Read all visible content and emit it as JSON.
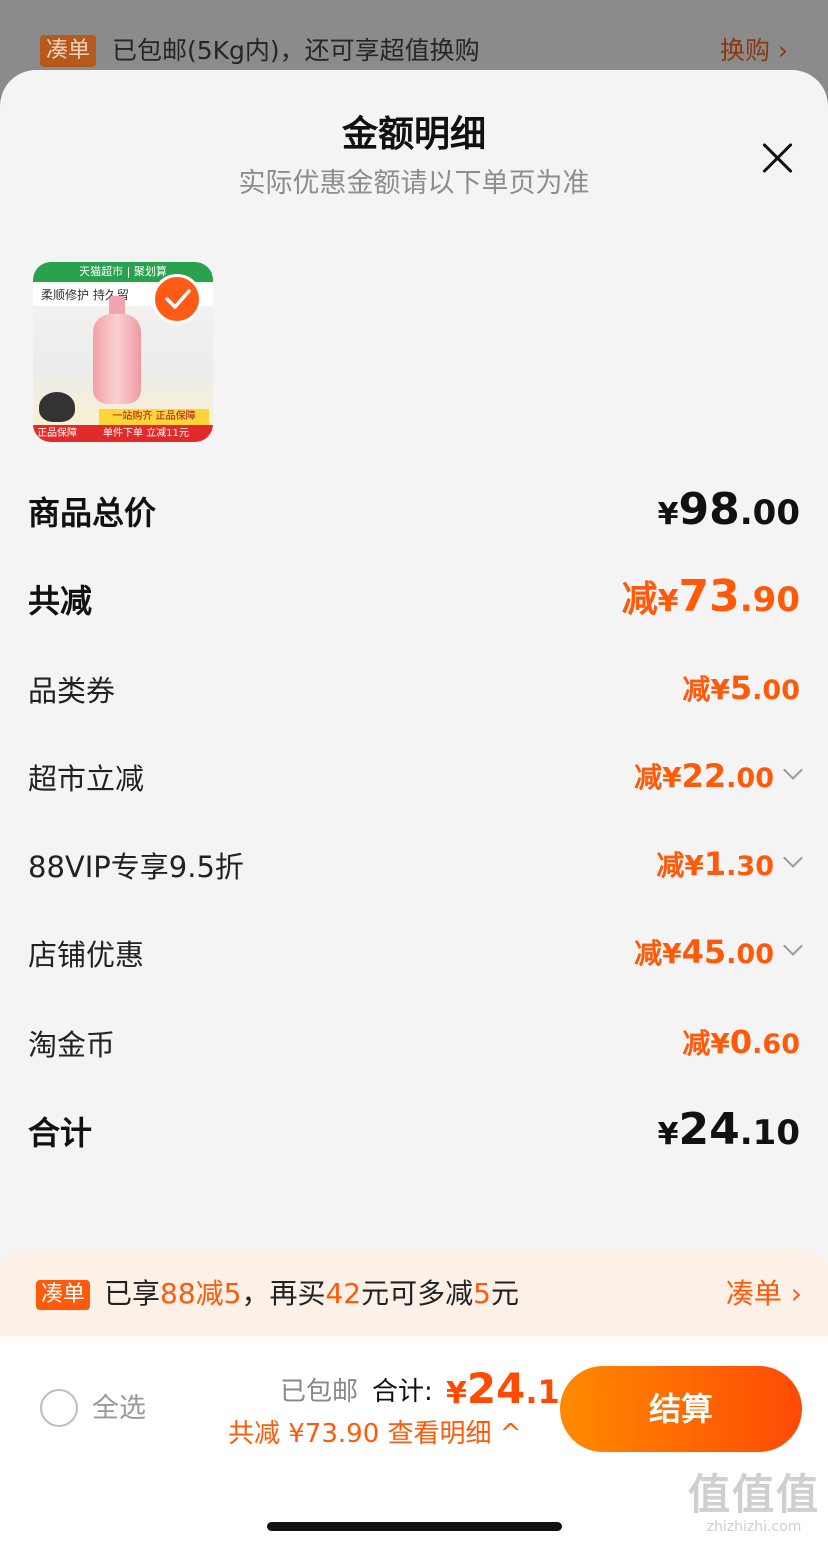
{
  "background_bar": {
    "tag": "凑单",
    "text": "已包邮(5Kg内)，还可享超值换购",
    "action": "换购 ›"
  },
  "sheet": {
    "title": "金额明细",
    "subtitle": "实际优惠金额请以下单页为准"
  },
  "product": {
    "banner": "天猫超市 | 聚划算",
    "slogan": "柔顺修护 持久留",
    "strip_yellow": "一站购齐 正品保障",
    "strip_red": "单件下单 立减11元",
    "guarantee": "正品保障"
  },
  "rows": {
    "total_price": {
      "label": "商品总价",
      "yen": "¥",
      "int": "98",
      "dec": ".00"
    },
    "total_discount": {
      "label": "共减",
      "prefix": "减",
      "yen": "¥",
      "int": "73",
      "dec": ".90"
    },
    "category_coupon": {
      "label": "品类券",
      "prefix": "减",
      "yen": "¥",
      "int": "5",
      "dec": ".00"
    },
    "supermarket_cut": {
      "label": "超市立减",
      "prefix": "减",
      "yen": "¥",
      "int": "22",
      "dec": ".00"
    },
    "vip": {
      "label": "88VIP专享9.5折",
      "prefix": "减",
      "yen": "¥",
      "int": "1",
      "dec": ".30"
    },
    "store": {
      "label": "店铺优惠",
      "prefix": "减",
      "yen": "¥",
      "int": "45",
      "dec": ".00"
    },
    "coins": {
      "label": "淘金币",
      "prefix": "减",
      "yen": "¥",
      "int": "0",
      "dec": ".60"
    },
    "sum": {
      "label": "合计",
      "yen": "¥",
      "int": "24",
      "dec": ".10"
    }
  },
  "promo": {
    "tag": "凑单",
    "t1": "已享",
    "h1": "88减5",
    "t2": "，再买",
    "h2": "42",
    "t3": "元可多减",
    "h3": "5",
    "t4": "元",
    "action": "凑单 ›"
  },
  "footer": {
    "select_all": "全选",
    "shipping": "已包邮",
    "total_label": "合计:",
    "total_yen": "¥",
    "total_int": "24",
    "total_dec": ".1",
    "savings": "共减 ¥73.90  查看明细 ^",
    "checkout": "结算"
  },
  "watermark": {
    "big": "值值值",
    "small": "zhizhizhi.com"
  },
  "colors": {
    "accent": "#ff5a0a",
    "checkout_start": "#ff8a00",
    "checkout_end": "#ff4a05"
  }
}
